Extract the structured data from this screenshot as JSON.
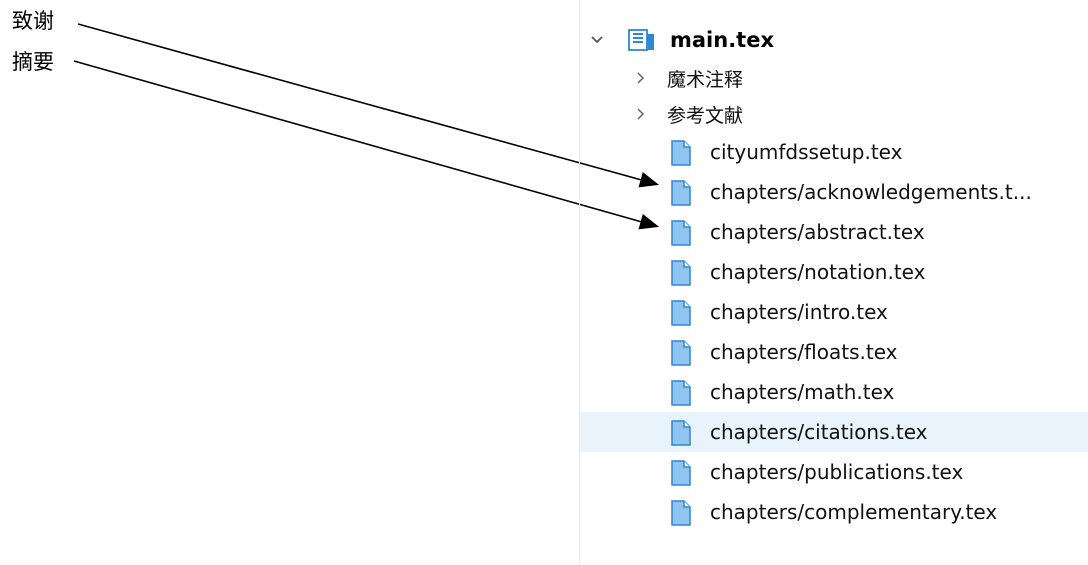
{
  "annotations": {
    "acknowledgements_label": "致谢",
    "abstract_label": "摘要",
    "arrow_color": "#000000"
  },
  "tree": {
    "root": {
      "label": "main.tex",
      "icon": "document-stack-icon",
      "expanded": true
    },
    "groups": [
      {
        "label": "魔术注释",
        "icon": "chevron-right-icon",
        "expanded": false
      },
      {
        "label": "参考文献",
        "icon": "chevron-right-icon",
        "expanded": false
      }
    ],
    "files": [
      {
        "label": "cityumfdssetup.tex",
        "icon": "file-icon"
      },
      {
        "label": "chapters/acknowledgements.t...",
        "icon": "file-icon"
      },
      {
        "label": "chapters/abstract.tex",
        "icon": "file-icon"
      },
      {
        "label": "chapters/notation.tex",
        "icon": "file-icon"
      },
      {
        "label": "chapters/intro.tex",
        "icon": "file-icon"
      },
      {
        "label": "chapters/floats.tex",
        "icon": "file-icon"
      },
      {
        "label": "chapters/math.tex",
        "icon": "file-icon"
      },
      {
        "label": "chapters/citations.tex",
        "icon": "file-icon",
        "selected": true
      },
      {
        "label": "chapters/publications.tex",
        "icon": "file-icon"
      },
      {
        "label": "chapters/complementary.tex",
        "icon": "file-icon"
      }
    ],
    "colors": {
      "file_icon_fill": "#8fc5f0",
      "file_icon_stroke": "#2f86d4",
      "selected_row": "#e9f3fc",
      "chevron": "#555555"
    }
  }
}
